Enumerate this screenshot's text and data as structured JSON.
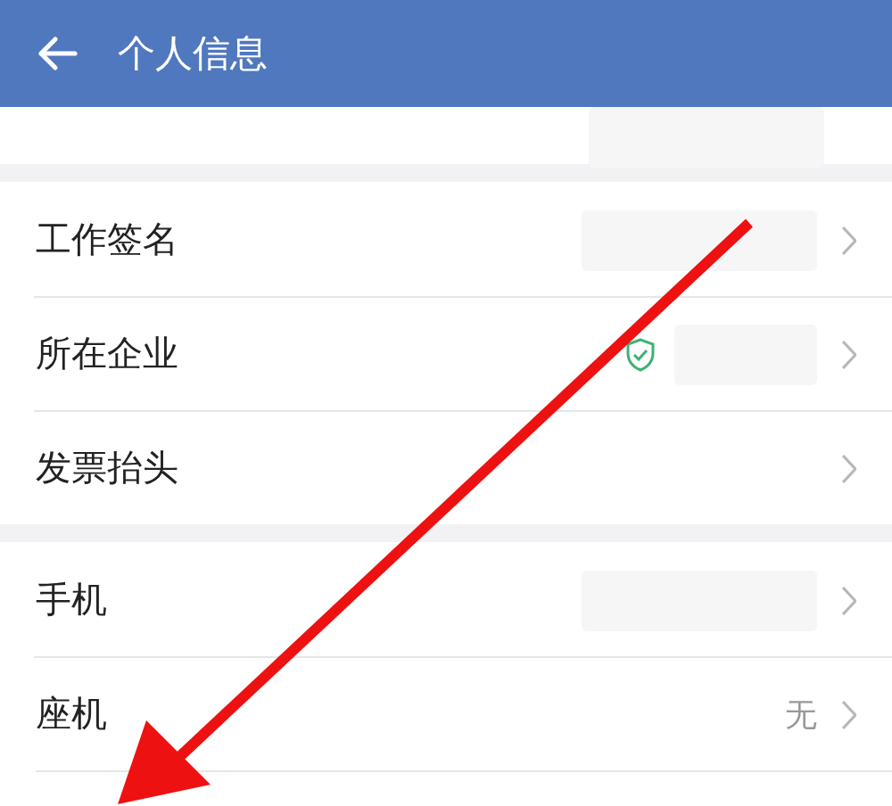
{
  "header": {
    "title": "个人信息"
  },
  "partial_row": {
    "blurred": true
  },
  "groups": [
    {
      "rows": [
        {
          "label": "工作签名",
          "blurred": true,
          "verified": false
        },
        {
          "label": "所在企业",
          "blurred": true,
          "verified": true
        },
        {
          "label": "发票抬头",
          "blurred": false,
          "verified": false
        }
      ]
    },
    {
      "rows": [
        {
          "label": "手机",
          "blurred": true,
          "verified": false
        },
        {
          "label": "座机",
          "value": "无",
          "blurred": false,
          "verified": false
        }
      ]
    }
  ]
}
